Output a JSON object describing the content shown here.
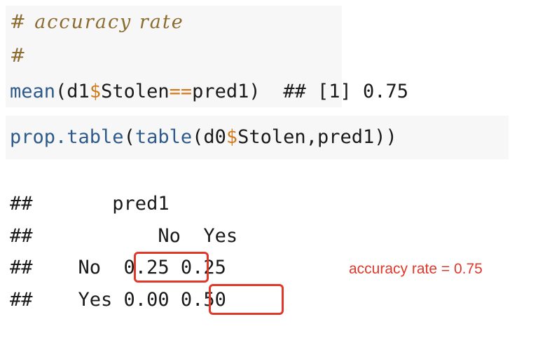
{
  "code_block1": {
    "comment1": "# accuracy rate",
    "comment2": "#",
    "line3": {
      "fn": "mean",
      "open": "(d1",
      "dollar": "$",
      "mid": "Stolen",
      "eq": "==",
      "rest": "pred1)",
      "output": "  ## [1] 0.75"
    }
  },
  "code_block2": {
    "fn1": "prop.table",
    "open1": "(",
    "fn2": "table",
    "open2": "(d0",
    "dollar": "$",
    "rest": "Stolen,pred1))"
  },
  "output": {
    "row1": "##       pred1",
    "row2": "##           No  Yes",
    "row3": "##    No  0.25 0.25",
    "row4": "##    Yes 0.00 0.50"
  },
  "annotation": "accuracy rate = 0.75",
  "colors": {
    "highlight": "#e0382b",
    "comment": "#8b6b2e",
    "function": "#2e5a8a",
    "operator": "#d07b1d"
  }
}
